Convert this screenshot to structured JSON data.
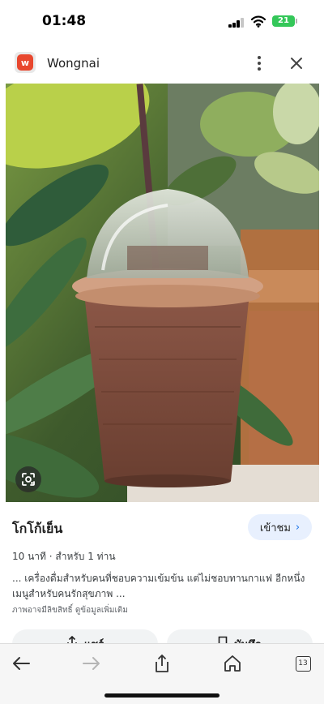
{
  "status_bar": {
    "time": "01:48",
    "battery": "21",
    "battery_color": "#34c759",
    "icons": [
      "signal-icon",
      "wifi-icon",
      "battery-icon"
    ]
  },
  "header": {
    "site_name": "Wongnai",
    "logo_letter": "w",
    "logo_color": "#e8472e",
    "icons": [
      "more-vert-icon",
      "close-icon"
    ]
  },
  "image": {
    "lens_icon": "google-lens-icon"
  },
  "result": {
    "title": "โกโก้เย็น",
    "visit_label": "เข้าชม",
    "meta": "10 นาที · สำหรับ 1 ท่าน",
    "description": "... เครื่องดื่มสำหรับคนที่ชอบความเข้มข้น แต่ไม่ชอบทานกาแฟ อีกหนึ่ง เมนูสำหรับคนรักสุขภาพ ...",
    "notice": "ภาพอาจมีลิขสิทธิ์ ดูข้อมูลเพิ่มเติม",
    "accent_color": "#1a73e8"
  },
  "actions": {
    "share_label": "แชร์",
    "save_label": "บันทึก"
  },
  "bottom_nav": {
    "tab_count": "13",
    "icons": [
      "back-arrow-icon",
      "forward-arrow-icon",
      "share-icon",
      "home-icon",
      "tabs-icon"
    ]
  }
}
